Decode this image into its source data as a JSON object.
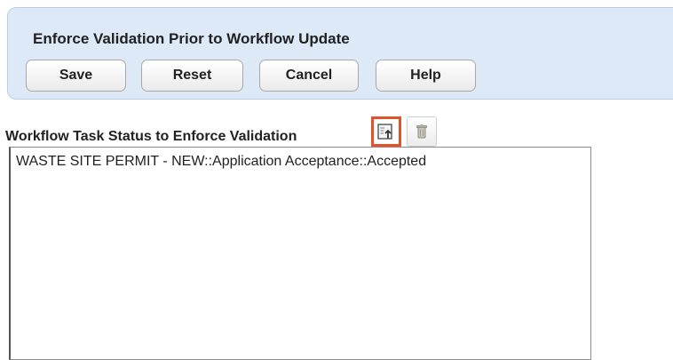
{
  "header": {
    "title": "Enforce Validation Prior to Workflow Update",
    "buttons": {
      "save": "Save",
      "reset": "Reset",
      "cancel": "Cancel",
      "help": "Help"
    }
  },
  "field": {
    "label": "Workflow Task Status to Enforce Validation",
    "add_icon": "add-task-status-icon",
    "delete_icon": "trash-icon",
    "highlight_color": "#e2532a",
    "items": [
      "WASTE SITE PERMIT - NEW::Application Acceptance::Accepted"
    ]
  }
}
